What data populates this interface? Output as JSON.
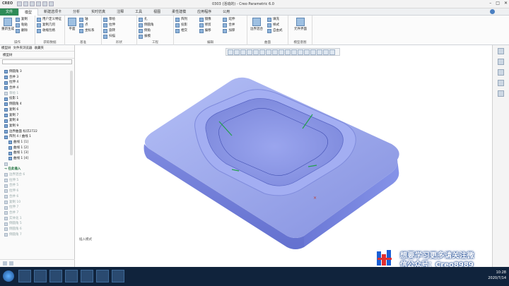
{
  "window": {
    "logo": "CREO",
    "title": "0303 (活动的) - Creo Parametric 6.0",
    "min": "–",
    "max": "□",
    "close": "✕"
  },
  "tabs": [
    "文件",
    "模型",
    "新建选项卡",
    "分析",
    "实时仿真",
    "注释",
    "工具",
    "视图",
    "柔性建模",
    "应用程序",
    "公用"
  ],
  "ribbon": {
    "groups": [
      {
        "caption": "操作",
        "items": [
          "重新生成",
          "复制",
          "粘贴",
          "删除"
        ]
      },
      {
        "caption": "获取数据",
        "items": [
          "用户定义特征",
          "复制几何",
          "收缩包络"
        ]
      },
      {
        "caption": "基准",
        "items": [
          "平面",
          "轴",
          "点",
          "坐标系"
        ]
      },
      {
        "caption": "形状",
        "items": [
          "草绘",
          "拉伸",
          "旋转",
          "扫描",
          "扫描混合"
        ]
      },
      {
        "caption": "工程",
        "items": [
          "孔",
          "倒圆角",
          "倒角",
          "拔模",
          "壳",
          "筋"
        ]
      },
      {
        "caption": "编辑",
        "items": [
          "阵列",
          "镜像",
          "延伸",
          "投影",
          "修剪",
          "合并",
          "相交",
          "偏移",
          "加厚",
          "实体化"
        ]
      },
      {
        "caption": "曲面",
        "items": [
          "边界混合",
          "填充",
          "样式",
          "自由式"
        ]
      },
      {
        "caption": "模型意图",
        "items": [
          "元件界面"
        ]
      }
    ]
  },
  "left_panel": {
    "tabs": [
      "模型树",
      "文件夹浏览器",
      "收藏夹"
    ],
    "tree_label": "模型树",
    "rows": [
      {
        "label": "倒圆角 3",
        "dim": false
      },
      {
        "label": "合并 3",
        "dim": false
      },
      {
        "label": "拉伸 4",
        "dim": false
      },
      {
        "label": "合并 4",
        "dim": false
      },
      {
        "label": "草绘 1",
        "dim": true
      },
      {
        "label": "投影 1",
        "dim": false
      },
      {
        "label": "倒圆角 4",
        "dim": false
      },
      {
        "label": "复制 6",
        "dim": false
      },
      {
        "label": "复制 7",
        "dim": false
      },
      {
        "label": "复制 8",
        "dim": false
      },
      {
        "label": "复制 9",
        "dim": false
      },
      {
        "label": "边界曲面 标识2722",
        "dim": false
      },
      {
        "label": "阵列 4 / 曲线 1",
        "dim": false
      },
      {
        "label": "曲线 1 [1]",
        "dim": false
      },
      {
        "label": "曲线 1 [2]",
        "dim": false
      },
      {
        "label": "曲线 1 [3]",
        "dim": false
      },
      {
        "label": "曲线 1 [4]",
        "dim": false
      },
      {
        "label": "",
        "dim": true
      },
      {
        "label": "→ 在此插入",
        "dim": false,
        "insert": true
      },
      {
        "label": "边界混合 6",
        "dim": true
      },
      {
        "label": "拉伸 5",
        "dim": true
      },
      {
        "label": "合并 5",
        "dim": true
      },
      {
        "label": "拉伸 6",
        "dim": true
      },
      {
        "label": "合并 6",
        "dim": true
      },
      {
        "label": "复制 10",
        "dim": true
      },
      {
        "label": "拉伸 7",
        "dim": true
      },
      {
        "label": "合并 7",
        "dim": true
      },
      {
        "label": "实体化 1",
        "dim": true
      },
      {
        "label": "倒圆角 5",
        "dim": true
      },
      {
        "label": "倒圆角 6",
        "dim": true
      },
      {
        "label": "倒圆角 7",
        "dim": true
      }
    ]
  },
  "graphics": {
    "status": "插入模式",
    "model_color": "#8f9ce6"
  },
  "taskbar": {
    "time": "10:28",
    "date": "2020/7/14"
  },
  "watermark": {
    "line1": "想要学习更多请关注微",
    "line2": "信公众号：Creo8989"
  }
}
